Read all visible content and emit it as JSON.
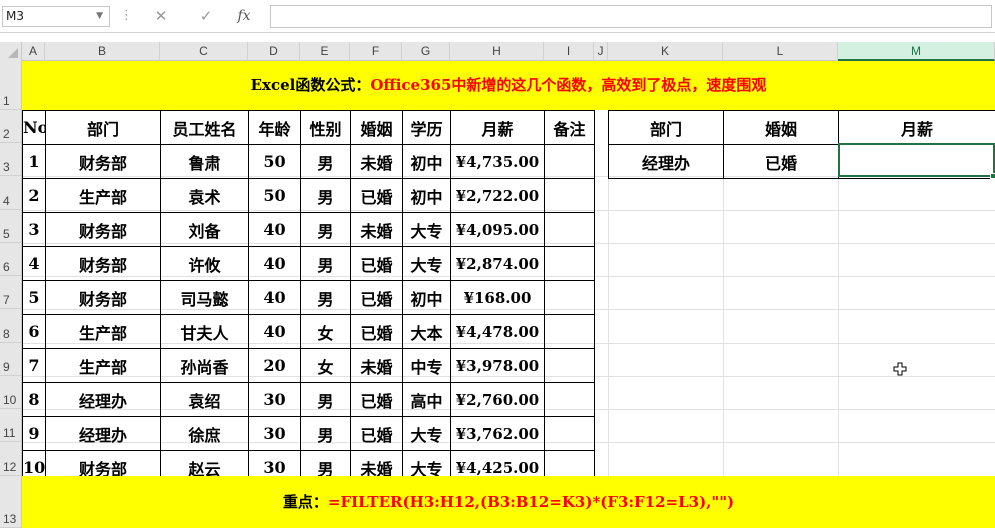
{
  "name_box": "M3",
  "formula_bar": {
    "fx_label": "fx",
    "cancel_symbol": "✕",
    "enter_symbol": "✓",
    "value": ""
  },
  "columns": [
    "A",
    "B",
    "C",
    "D",
    "E",
    "F",
    "G",
    "H",
    "I",
    "J",
    "K",
    "L",
    "M"
  ],
  "selected_column": "M",
  "rows": [
    "1",
    "2",
    "3",
    "4",
    "5",
    "6",
    "7",
    "8",
    "9",
    "10",
    "11",
    "12",
    "13"
  ],
  "title": {
    "prefix": "Excel函数公式：",
    "text": "Office365中新增的这几个函数，高效到了极点，速度围观"
  },
  "main_table": {
    "headers": [
      "No",
      "部门",
      "员工姓名",
      "年龄",
      "性别",
      "婚姻",
      "学历",
      "月薪",
      "备注"
    ],
    "rows": [
      [
        "1",
        "财务部",
        "鲁肃",
        "50",
        "男",
        "未婚",
        "初中",
        "¥4,735.00",
        ""
      ],
      [
        "2",
        "生产部",
        "袁术",
        "50",
        "男",
        "已婚",
        "初中",
        "¥2,722.00",
        ""
      ],
      [
        "3",
        "财务部",
        "刘备",
        "40",
        "男",
        "未婚",
        "大专",
        "¥4,095.00",
        ""
      ],
      [
        "4",
        "财务部",
        "许攸",
        "40",
        "男",
        "已婚",
        "大专",
        "¥2,874.00",
        ""
      ],
      [
        "5",
        "财务部",
        "司马懿",
        "40",
        "男",
        "已婚",
        "初中",
        "¥168.00",
        ""
      ],
      [
        "6",
        "生产部",
        "甘夫人",
        "40",
        "女",
        "已婚",
        "大本",
        "¥4,478.00",
        ""
      ],
      [
        "7",
        "生产部",
        "孙尚香",
        "20",
        "女",
        "未婚",
        "中专",
        "¥3,978.00",
        ""
      ],
      [
        "8",
        "经理办",
        "袁绍",
        "30",
        "男",
        "已婚",
        "高中",
        "¥2,760.00",
        ""
      ],
      [
        "9",
        "经理办",
        "徐庶",
        "30",
        "男",
        "已婚",
        "大专",
        "¥3,762.00",
        ""
      ],
      [
        "10",
        "财务部",
        "赵云",
        "30",
        "男",
        "未婚",
        "大专",
        "¥4,425.00",
        ""
      ]
    ]
  },
  "criteria_table": {
    "headers": [
      "部门",
      "婚姻",
      "月薪"
    ],
    "row": [
      "经理办",
      "已婚",
      ""
    ]
  },
  "footer": {
    "label": "重点：",
    "formula": "=FILTER(H3:H12,(B3:B12=K3)*(F3:F12=L3),\"\")"
  },
  "colors": {
    "band": "#ffff00",
    "accent_red": "#ff0000",
    "selection_green": "#217346"
  },
  "icons": {
    "cursor": "cell-select-cursor-icon"
  }
}
